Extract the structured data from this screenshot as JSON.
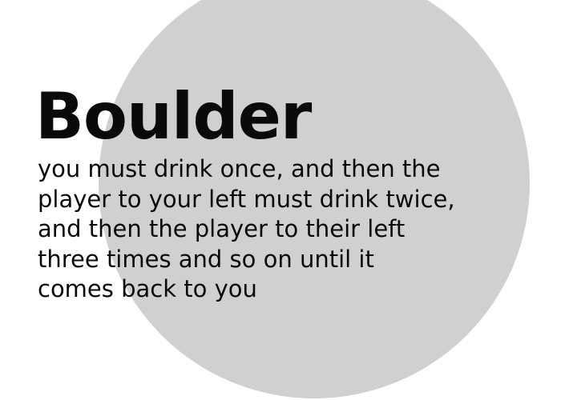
{
  "card": {
    "title": "Boulder",
    "description_lines": [
      "you must drink once, and then the",
      "player to your left must drink twice,",
      "and then the player to their left",
      "three times and so on until it",
      "comes back to you"
    ]
  },
  "colors": {
    "background": "#ffffff",
    "circle": "#d0d0d0",
    "text": "#0a0a0a"
  }
}
